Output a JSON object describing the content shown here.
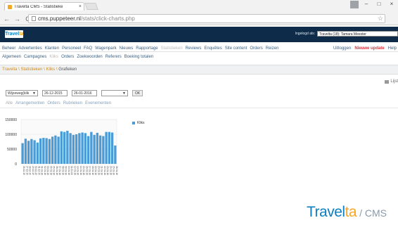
{
  "browser": {
    "tab_title": "Travelta CMS - Statistieke",
    "tab_close": "×",
    "url_domain": "cms.puppeteer.nl",
    "url_path": "/stats/click-charts.php",
    "minimize": "–",
    "maximize": "□",
    "close": "×"
  },
  "header": {
    "logo_main": "Travel",
    "logo_accent": "ta",
    "login_label": "Ingelogd als:",
    "login_user": "Travelta (18): Tamara Meester"
  },
  "menu_main": {
    "items": [
      "Beheer",
      "Advertenties",
      "Klanten",
      "Personeel",
      "FAQ",
      "Wagenpark",
      "Nieuws",
      "Rapportage",
      "Statistieken",
      "Reviews",
      "Enquêtes",
      "Site content",
      "Orders",
      "Reizen"
    ],
    "active_index": 8,
    "logout": "Uitloggen",
    "update": "Nieuwe update",
    "help": "Help"
  },
  "menu_sub": {
    "items": [
      "Algemeen",
      "Campagnes",
      "Kliks",
      "Orders",
      "Zoekwoorden",
      "Referers",
      "Boeking totalen"
    ],
    "active_index": 2
  },
  "breadcrumb": {
    "items": [
      "Travelta",
      "Statistieken",
      "Kliks",
      "Grafieken"
    ],
    "separator": " \\ "
  },
  "toolbar": {
    "list_label": "Lijst"
  },
  "filter": {
    "period": "Wijzeweg(klik",
    "date_from": "26-12-2015",
    "date_to": "26-01-2016",
    "select_value": "",
    "ok": "OK"
  },
  "subtabs": {
    "items": [
      "Alle",
      "Arrangementen",
      "Orders",
      "Rubrieken",
      "Evenementen"
    ],
    "active_index": 0
  },
  "chart_data": {
    "type": "bar",
    "title": "",
    "xlabel": "",
    "ylabel": "",
    "ylim": [
      0,
      150000
    ],
    "yticks": [
      "150000",
      "100000",
      "50000",
      "0"
    ],
    "legend": "Kliks",
    "color": "#4a9bd6",
    "categories": [
      "26-12-15",
      "27-12-15",
      "28-12-15",
      "29-12-15",
      "30-12-15",
      "31-12-15",
      "01-01-16",
      "02-01-16",
      "03-01-16",
      "04-01-16",
      "05-01-16",
      "06-01-16",
      "07-01-16",
      "08-01-16",
      "09-01-16",
      "10-01-16",
      "11-01-16",
      "12-01-16",
      "13-01-16",
      "14-01-16",
      "15-01-16",
      "16-01-16",
      "17-01-16",
      "18-01-16",
      "19-01-16",
      "20-01-16",
      "21-01-16",
      "22-01-16",
      "23-01-16",
      "24-01-16",
      "25-01-16",
      "26-01-16"
    ],
    "values": [
      70000,
      85000,
      78000,
      84000,
      80000,
      72000,
      86000,
      88000,
      87000,
      84000,
      92000,
      96000,
      92000,
      110000,
      108000,
      112000,
      104000,
      98000,
      100000,
      104000,
      106000,
      104000,
      94000,
      108000,
      98000,
      105000,
      96000,
      94000,
      108000,
      108000,
      106000,
      62000
    ]
  },
  "footer": {
    "logo_main": "Travel",
    "logo_accent": "ta",
    "suffix": "/ CMS"
  }
}
